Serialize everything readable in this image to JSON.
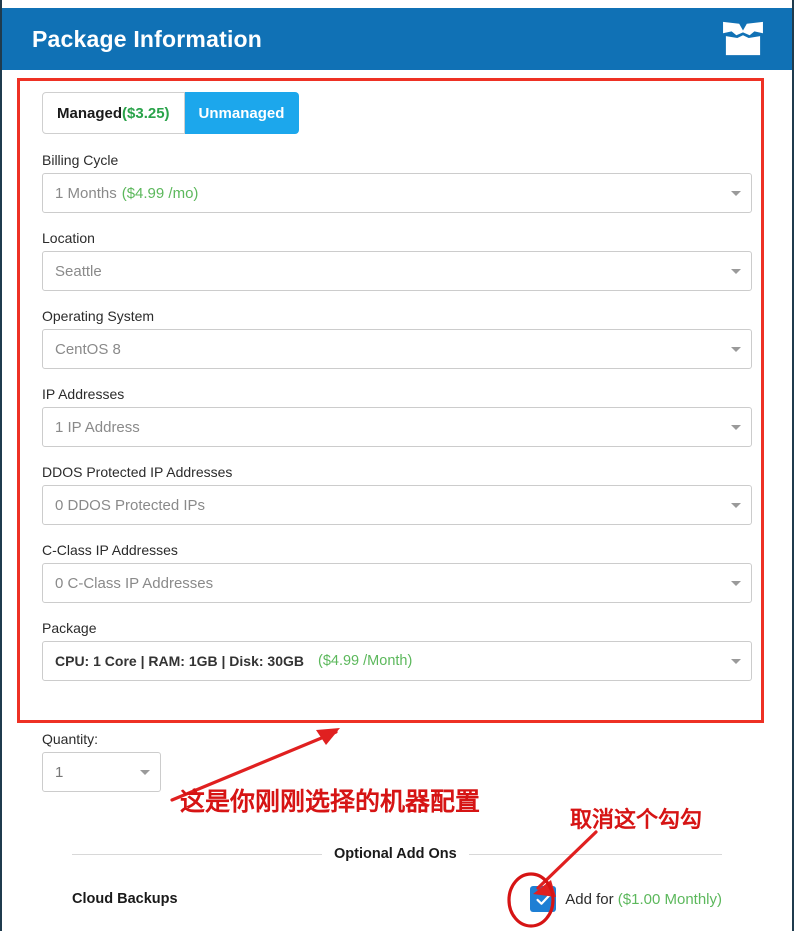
{
  "header": {
    "title": "Package Information",
    "icon": "package-box-icon",
    "background_color": "#1071b5"
  },
  "tabs": [
    {
      "label": "Managed",
      "price": "($3.25)",
      "active": false
    },
    {
      "label": "Unmanaged",
      "price": "",
      "active": true
    }
  ],
  "fields": [
    {
      "label": "Billing Cycle",
      "value": "1 Months",
      "price": "($4.99 /mo)",
      "bold": false
    },
    {
      "label": "Location",
      "value": "Seattle",
      "price": "",
      "bold": false
    },
    {
      "label": "Operating System",
      "value": "CentOS 8",
      "price": "",
      "bold": false
    },
    {
      "label": "IP Addresses",
      "value": "1 IP Address",
      "price": "",
      "bold": false
    },
    {
      "label": "DDOS Protected IP Addresses",
      "value": "0 DDOS Protected IPs",
      "price": "",
      "bold": false
    },
    {
      "label": "C-Class IP Addresses",
      "value": "0 C-Class IP Addresses",
      "price": "",
      "bold": false
    },
    {
      "label": "Package",
      "value": "CPU: 1 Core | RAM: 1GB | Disk: 30GB",
      "price": "($4.99 /Month)",
      "bold": true
    }
  ],
  "quantity": {
    "label": "Quantity:",
    "value": "1"
  },
  "addons": {
    "section_title": "Optional Add Ons",
    "items": [
      {
        "name": "Cloud Backups",
        "checked": true,
        "add_label": "Add for",
        "price": "($1.00 Monthly)"
      }
    ]
  },
  "annotations": {
    "config_note": "这是你刚刚选择的机器配置",
    "uncheck_note": "取消这个勾勾",
    "highlight_color": "#ee3124",
    "note_color": "#d61414"
  },
  "colors": {
    "header_blue": "#1071b5",
    "tab_active_blue": "#1ca7ec",
    "price_green": "#5cb85c",
    "checkbox_blue": "#1e7fd4",
    "annotation_red": "#d61414"
  }
}
